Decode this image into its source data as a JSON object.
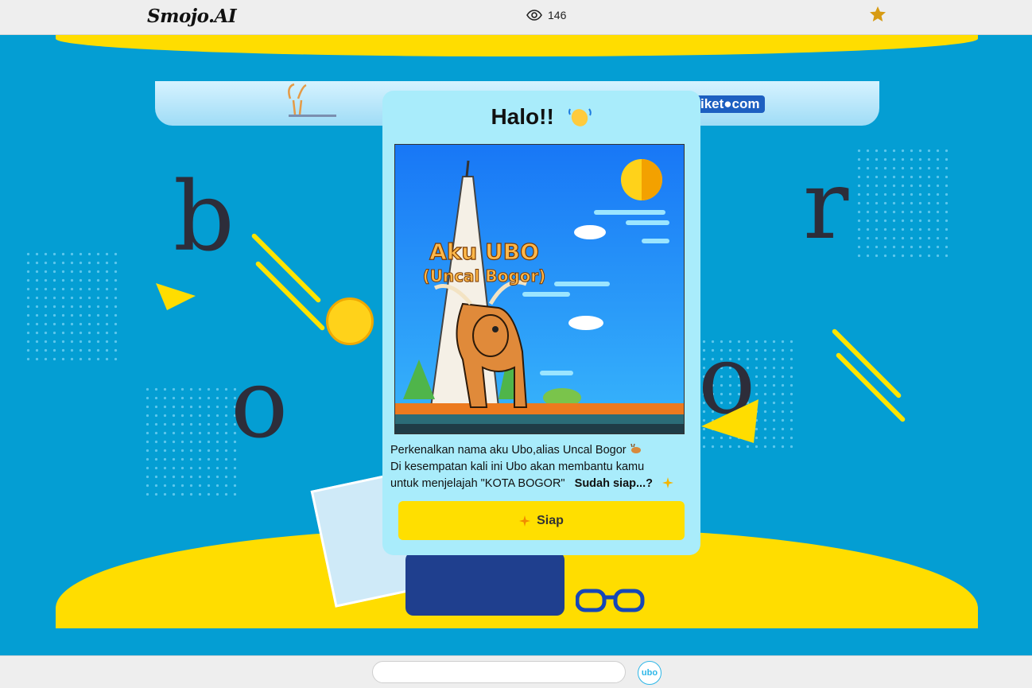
{
  "header": {
    "logo_text": "Smojo.AI",
    "view_count": "146",
    "view_icon": "eye-icon",
    "favorite_icon": "star-icon",
    "favorite_color": "#d79b13"
  },
  "background": {
    "colors": {
      "sky": "#049ed3",
      "wave": "#ffdd00"
    },
    "letters": [
      "b",
      "r",
      "o",
      "o"
    ],
    "banner_partner": "tiket.com",
    "banner_partner_display": "iket●com"
  },
  "modal": {
    "title": "Halo!!",
    "title_icon": "waving-hand-icon",
    "poster": {
      "title_line1": "Aku UBO",
      "title_line2": "(Uncal Bogor)"
    },
    "intro_line1": "Perkenalkan nama aku Ubo,alias Uncal Bogor",
    "intro_line2": "Di kesempatan kali ini Ubo akan membantu kamu",
    "intro_line3": "untuk menjelajah \"KOTA BOGOR\"",
    "intro_question": "Sudah siap...?",
    "button_label": "Siap",
    "button_color": "#ffdf00"
  },
  "footer": {
    "input_value": "",
    "send_button_label": "ubo"
  }
}
